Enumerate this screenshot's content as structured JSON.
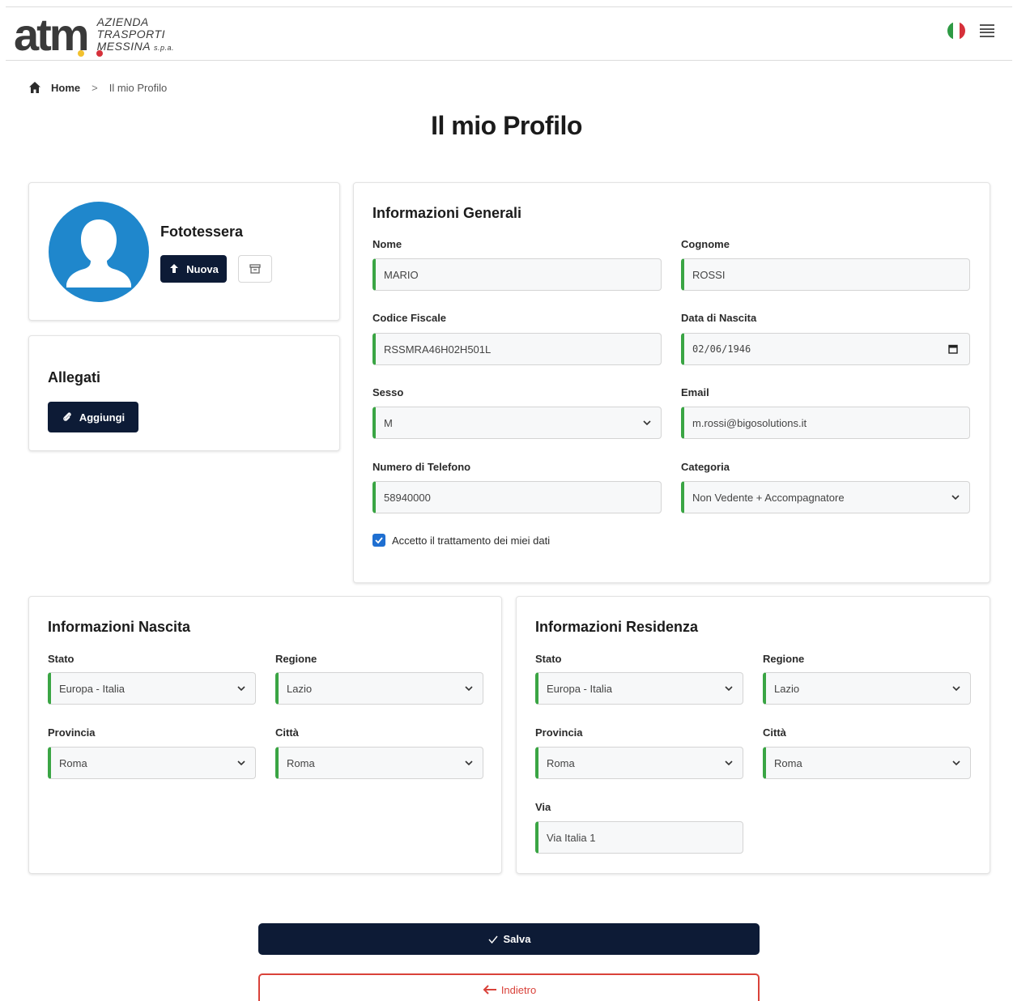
{
  "header": {
    "logo_mark": "atm",
    "logo_lines": [
      "AZIENDA",
      "TRASPORTI",
      "MESSINA"
    ],
    "logo_spa": "s.p.a.",
    "flag_colors": [
      "#2e9a44",
      "#ffffff",
      "#d6303a"
    ],
    "menu_icon": "hamburger-icon"
  },
  "breadcrumb": {
    "home": "Home",
    "separator": ">",
    "current": "Il mio Profilo"
  },
  "page_title": "Il mio Profilo",
  "photo_card": {
    "title": "Fototessera",
    "new_button": "Nuova",
    "delete_icon": "archive-icon"
  },
  "attachments_card": {
    "title": "Allegati",
    "add_button": "Aggiungi"
  },
  "general_info": {
    "title": "Informazioni Generali",
    "nome_label": "Nome",
    "nome_value": "MARIO",
    "cognome_label": "Cognome",
    "cognome_value": "ROSSI",
    "cf_label": "Codice Fiscale",
    "cf_value": "RSSMRA46H02H501L",
    "dob_label": "Data di Nascita",
    "dob_value": "02/06/1946",
    "sesso_label": "Sesso",
    "sesso_value": "M",
    "email_label": "Email",
    "email_value": "m.rossi@bigosolutions.it",
    "phone_label": "Numero di Telefono",
    "phone_value": "58940000",
    "categoria_label": "Categoria",
    "categoria_value": "Non Vedente + Accompagnatore",
    "consent_label": "Accetto il trattamento dei miei dati",
    "consent_checked": true
  },
  "birth_info": {
    "title": "Informazioni Nascita",
    "stato_label": "Stato",
    "stato_value": "Europa - Italia",
    "regione_label": "Regione",
    "regione_value": "Lazio",
    "provincia_label": "Provincia",
    "provincia_value": "Roma",
    "citta_label": "Città",
    "citta_value": "Roma"
  },
  "residence_info": {
    "title": "Informazioni Residenza",
    "stato_label": "Stato",
    "stato_value": "Europa - Italia",
    "regione_label": "Regione",
    "regione_value": "Lazio",
    "provincia_label": "Provincia",
    "provincia_value": "Roma",
    "citta_label": "Città",
    "citta_value": "Roma",
    "via_label": "Via",
    "via_value": "Via Italia 1"
  },
  "actions": {
    "save": "Salva",
    "back": "Indietro"
  },
  "colors": {
    "primary_dark": "#0d1b36",
    "accent_green": "#3aa544",
    "avatar_blue": "#1f87cc",
    "danger_red": "#d9423a"
  }
}
